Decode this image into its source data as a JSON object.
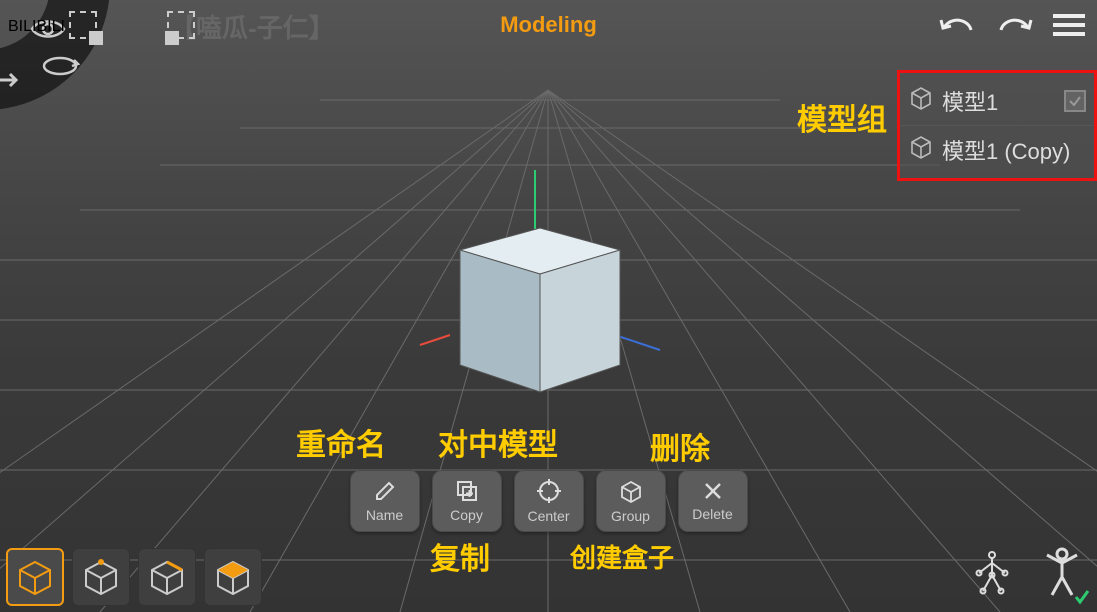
{
  "header": {
    "title": "Modeling",
    "watermark_logo": "BILIBILI",
    "watermark_cn": "【嗑瓜-子仁】"
  },
  "annotations": {
    "model_group": "模型组",
    "rename": "重命名",
    "center_model": "对中模型",
    "delete": "删除",
    "copy": "复制",
    "create_box": "创建盒子"
  },
  "actions": {
    "name": "Name",
    "copy": "Copy",
    "center": "Center",
    "group": "Group",
    "delete": "Delete"
  },
  "models": {
    "item1": "模型1",
    "item2": "模型1 (Copy)"
  },
  "colors": {
    "accent": "#f39c12",
    "annotation": "#ffcc00",
    "panel_border": "#e11"
  }
}
